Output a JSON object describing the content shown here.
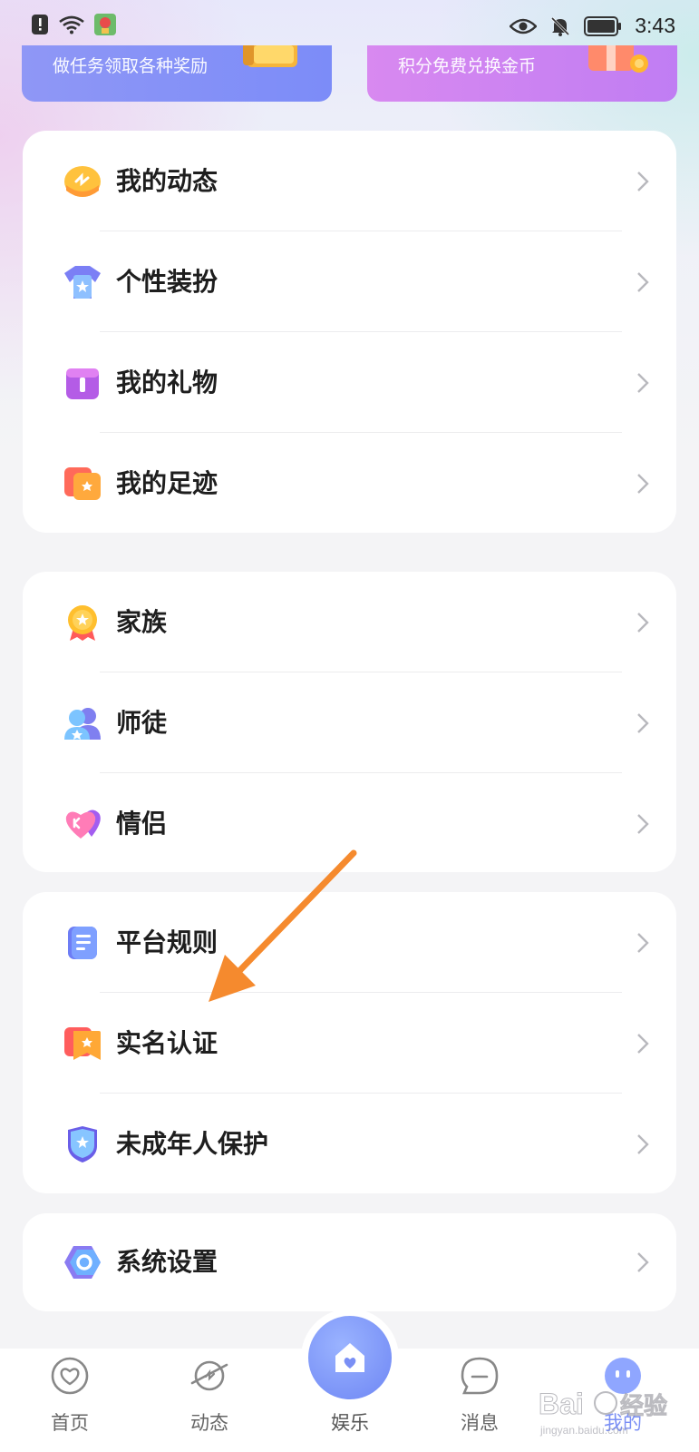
{
  "status_bar": {
    "time": "3:43",
    "icons": [
      "alert-icon",
      "wifi-icon",
      "app-notification-icon",
      "eye-icon",
      "bell-off-icon",
      "battery-icon"
    ]
  },
  "promos": [
    {
      "text": "做任务领取各种奖励",
      "color": "#8f97f6"
    },
    {
      "text": "积分免费兑换金币",
      "color": "#d889f0"
    }
  ],
  "groups": [
    {
      "items": [
        {
          "label": "我的动态",
          "icon": "moments-icon"
        },
        {
          "label": "个性装扮",
          "icon": "outfit-icon"
        },
        {
          "label": "我的礼物",
          "icon": "gift-icon"
        },
        {
          "label": "我的足迹",
          "icon": "footprint-icon"
        }
      ]
    },
    {
      "items": [
        {
          "label": "家族",
          "icon": "family-medal-icon"
        },
        {
          "label": "师徒",
          "icon": "mentor-icon"
        },
        {
          "label": "情侣",
          "icon": "couple-heart-icon"
        }
      ]
    },
    {
      "items": [
        {
          "label": "平台规则",
          "icon": "rules-doc-icon"
        },
        {
          "label": "实名认证",
          "icon": "realname-icon"
        },
        {
          "label": "未成年人保护",
          "icon": "shield-icon"
        }
      ]
    },
    {
      "items": [
        {
          "label": "系统设置",
          "icon": "settings-icon"
        }
      ]
    }
  ],
  "tabbar": {
    "tabs": [
      {
        "label": "首页",
        "icon": "home-heart-icon"
      },
      {
        "label": "动态",
        "icon": "planet-icon"
      },
      {
        "label": "娱乐",
        "icon": "house-heart-icon"
      },
      {
        "label": "消息",
        "icon": "message-icon"
      },
      {
        "label": "我的",
        "icon": "profile-face-icon"
      }
    ]
  },
  "watermark": "Baidu 经验"
}
